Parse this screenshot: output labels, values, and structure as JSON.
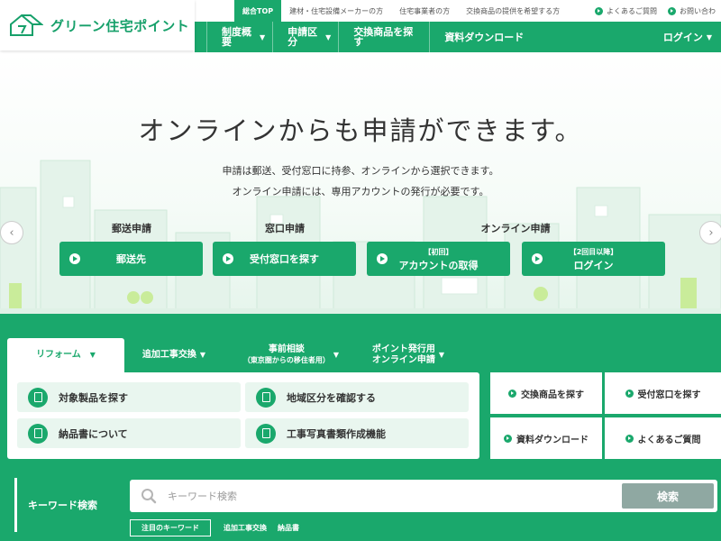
{
  "header": {
    "logo_text": "グリーン住宅ポイント",
    "utility_tabs": [
      {
        "label": "総合TOP"
      },
      {
        "label": "建材・住宅設備メーカーの方"
      },
      {
        "label": "住宅事業者の方"
      },
      {
        "label": "交換商品の提供を希望する方"
      }
    ],
    "utility_links": [
      {
        "label": "よくあるご質問"
      },
      {
        "label": "お問い合わ"
      }
    ],
    "nav": [
      {
        "label": "制度概要"
      },
      {
        "label": "申請区分"
      },
      {
        "label": "交換商品を探す"
      },
      {
        "label": "資料ダウンロード"
      }
    ],
    "login_label": "ログイン"
  },
  "hero": {
    "title": "オンラインからも申請ができます。",
    "desc_line1": "申請は郵送、受付窓口に持参、オンラインから選択できます。",
    "desc_line2": "オンライン申請には、専用アカウントの発行が必要です。",
    "categories": [
      "郵送申請",
      "窓口申請",
      "オンライン申請"
    ],
    "buttons": [
      {
        "label": "郵送先",
        "small": ""
      },
      {
        "label": "受付窓口を探す",
        "small": ""
      },
      {
        "label": "アカウントの取得",
        "small": "【初回】"
      },
      {
        "label": "ログイン",
        "small": "【2回目以降】"
      }
    ]
  },
  "tabs": [
    {
      "label": "リフォーム",
      "sub": ""
    },
    {
      "label": "追加工事交換",
      "sub": ""
    },
    {
      "label": "事前相談",
      "sub": "（東京圏からの移住者用）"
    },
    {
      "label": "ポイント発行用",
      "sub": "オンライン申請"
    }
  ],
  "cards": [
    {
      "label": "対象製品を探す",
      "icon": "search-document-icon"
    },
    {
      "label": "地域区分を確認する",
      "icon": "map-icon"
    },
    {
      "label": "納品書について",
      "icon": "document-icon"
    },
    {
      "label": "工事写真書類作成機能",
      "icon": "document-icon"
    }
  ],
  "quick_links": [
    {
      "label": "交換商品を探す"
    },
    {
      "label": "受付窓口を探す"
    },
    {
      "label": "資料ダウンロード"
    },
    {
      "label": "よくあるご質問"
    }
  ],
  "search": {
    "label": "キーワード検索",
    "placeholder": "キーワード検索",
    "button": "検索",
    "tags_title": "注目のキーワード",
    "tags": [
      "追加工事交換",
      "納品書"
    ]
  },
  "colors": {
    "brand_green": "#1aa86c",
    "card_bg": "#e9f6ef",
    "search_button": "#8fa8a2"
  }
}
